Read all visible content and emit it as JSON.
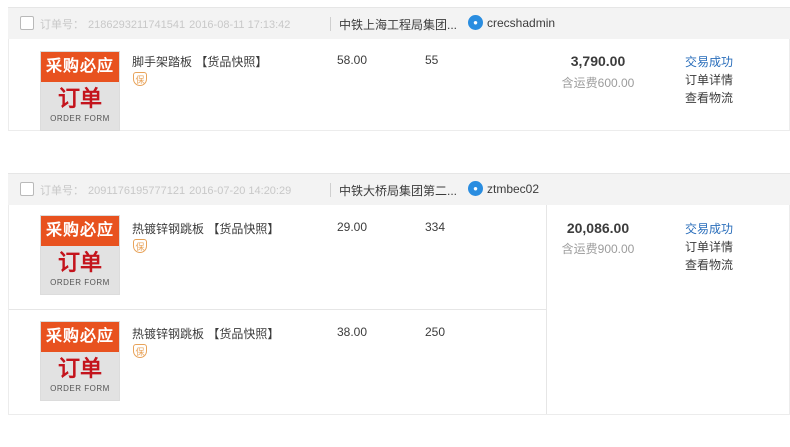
{
  "orders": [
    {
      "order_label": "订单号：",
      "order_no": "2186293211741541",
      "order_time": "2016-08-11 17:13:42",
      "shop": "中铁上海工程局集团...",
      "seller": "crecshadmin",
      "items": [
        {
          "thumb": {
            "top": "采购必应",
            "big": "订单",
            "small": "ORDER FORM"
          },
          "name": "脚手架踏板",
          "snapshot": "【货品快照】",
          "shield_icon": "shield-icon",
          "shield_text": "保",
          "price": "58.00",
          "qty": "55"
        }
      ],
      "total": "3,790.00",
      "shipping": "含运费600.00",
      "status": "交易成功",
      "detail_link": "订单详情",
      "logistics_link": "查看物流"
    },
    {
      "order_label": "订单号：",
      "order_no": "2091176195777121",
      "order_time": "2016-07-20 14:20:29",
      "shop": "中铁大桥局集团第二...",
      "seller": "ztmbec02",
      "items": [
        {
          "thumb": {
            "top": "采购必应",
            "big": "订单",
            "small": "ORDER FORM"
          },
          "name": "热镀锌钢跳板",
          "snapshot": "【货品快照】",
          "shield_icon": "shield-icon",
          "shield_text": "保",
          "price": "29.00",
          "qty": "334"
        },
        {
          "thumb": {
            "top": "采购必应",
            "big": "订单",
            "small": "ORDER FORM"
          },
          "name": "热镀锌钢跳板",
          "snapshot": "【货品快照】",
          "shield_icon": "shield-icon",
          "shield_text": "保",
          "price": "38.00",
          "qty": "250"
        }
      ],
      "total": "20,086.00",
      "shipping": "含运费900.00",
      "status": "交易成功",
      "detail_link": "订单详情",
      "logistics_link": "查看物流"
    }
  ],
  "colors": {
    "accent_link": "#2a6ebb",
    "thumb_orange": "#e8521f",
    "thumb_red": "#c4141c",
    "header_bg": "#f3f3f3"
  }
}
